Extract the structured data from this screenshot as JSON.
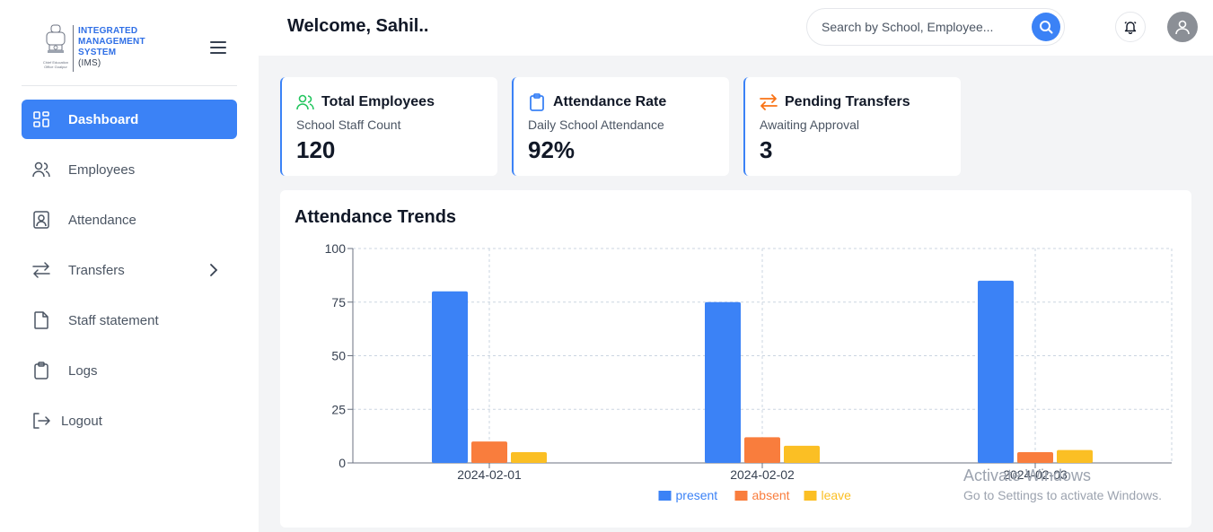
{
  "brand": {
    "line1": "INTEGRATED",
    "line2": "MANAGEMENT",
    "line3": "SYSTEM",
    "line4": "(IMS)",
    "emblem_caption_1": "Chief Education",
    "emblem_caption_2": "Office Goalpur"
  },
  "sidebar": {
    "items": [
      {
        "label": "Dashboard",
        "icon": "dashboard-grid-icon"
      },
      {
        "label": "Employees",
        "icon": "users-icon"
      },
      {
        "label": "Attendance",
        "icon": "id-badge-icon"
      },
      {
        "label": "Transfers",
        "icon": "transfer-arrows-icon"
      },
      {
        "label": "Staff statement",
        "icon": "file-icon"
      },
      {
        "label": "Logs",
        "icon": "clipboard-icon"
      },
      {
        "label": "Logout",
        "icon": "logout-icon"
      }
    ]
  },
  "header": {
    "welcome": "Welcome, Sahil..",
    "search_placeholder": "Search by School, Employee..."
  },
  "cards": [
    {
      "title": "Total Employees",
      "subtitle": "School Staff Count",
      "value": "120",
      "icon": "users-icon",
      "icon_color": "#22c55e"
    },
    {
      "title": "Attendance Rate",
      "subtitle": "Daily School Attendance",
      "value": "92%",
      "icon": "clipboard-icon",
      "icon_color": "#3b82f6"
    },
    {
      "title": "Pending Transfers",
      "subtitle": "Awaiting Approval",
      "value": "3",
      "icon": "transfer-arrows-icon",
      "icon_color": "#f97316"
    }
  ],
  "chart_data": {
    "type": "bar",
    "title": "Attendance Trends",
    "categories": [
      "2024-02-01",
      "2024-02-02",
      "2024-02-03"
    ],
    "series": [
      {
        "name": "present",
        "values": [
          80,
          75,
          85
        ],
        "color": "#3b82f6"
      },
      {
        "name": "absent",
        "values": [
          10,
          12,
          5
        ],
        "color": "#f97d3d"
      },
      {
        "name": "leave",
        "values": [
          5,
          8,
          6
        ],
        "color": "#fbbf24"
      }
    ],
    "ylim": [
      0,
      100
    ],
    "yticks": [
      0,
      25,
      50,
      75,
      100
    ],
    "grid": true,
    "legend": "bottom-center"
  },
  "watermark": {
    "line1": "Activate Windows",
    "line2": "Go to Settings to activate Windows."
  },
  "colors": {
    "accent": "#3b82f6",
    "sidebar_bg": "#ffffff",
    "page_bg": "#f3f4f6"
  }
}
